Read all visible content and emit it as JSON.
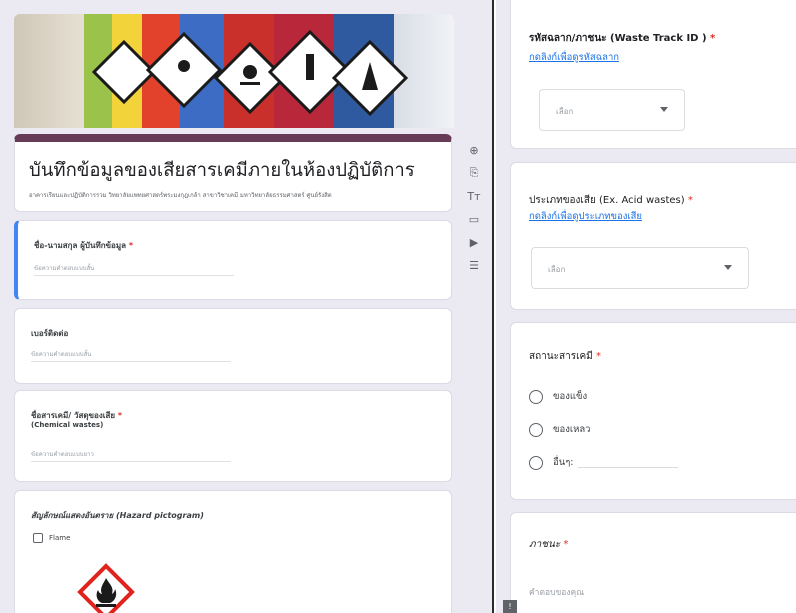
{
  "form": {
    "title": "บันทึกข้อมูลของเสียสารเคมีภายในห้องปฏิบัติการ",
    "description": "อาคารเรียนและปฏิบัติการรวม วิทยาลัยแพทยศาสตร์พระมงกุฎเกล้า สาขาวิชาเคมี มหาวิทยาลัยธรรมศาสตร์ ศูนย์รังสิต"
  },
  "left_questions": {
    "name": {
      "label": "ชื่อ-นามสกุล ผู้บันทึกข้อมูล",
      "required_mark": "*",
      "placeholder": "ข้อความคำตอบแบบสั้น"
    },
    "phone": {
      "label": "เบอร์ติดต่อ",
      "placeholder": "ข้อความคำตอบแบบสั้น"
    },
    "chemical": {
      "label": "ชื่อสารเคมี/ วัสดุของเสีย",
      "required_mark": "*",
      "sublabel": "(Chemical wastes)",
      "placeholder": "ข้อความคำตอบแบบยาว"
    },
    "hazard": {
      "label": "สัญลักษณ์แสดงอันตราย (Hazard pictogram)",
      "option": "Flame"
    }
  },
  "toolbar": {
    "icons": [
      "add-question-icon",
      "import-icon",
      "title-text-icon",
      "image-icon",
      "video-icon",
      "section-icon"
    ],
    "glyphs": [
      "⊕",
      "⎘",
      "Tт",
      "▭",
      "▶",
      "☰"
    ]
  },
  "right_questions": {
    "track_id": {
      "label": "รหัสฉลาก/ภาชนะ (Waste Track ID )",
      "required_mark": "*",
      "link": "กดลิงก์เพื่อดูรหัสฉลาก",
      "select": "เลือก"
    },
    "waste_type": {
      "label": "ประเภทของเสีย (Ex. Acid wastes)",
      "required_mark": "*",
      "link": "กดลิงก์เพื่อดูประเภทของเสีย",
      "select": "เลือก"
    },
    "state": {
      "label": "สถานะสารเคมี",
      "required_mark": "*",
      "options": [
        "ของแข็ง",
        "ของเหลว",
        "อื่นๆ:"
      ]
    },
    "container": {
      "label": "ภาชนะ",
      "required_mark": "*",
      "placeholder": "คำตอบของคุณ"
    }
  },
  "colors": {
    "accent": "#673a55",
    "link": "#1a73e8",
    "required": "#d93025",
    "background": "#ebe9f1"
  }
}
